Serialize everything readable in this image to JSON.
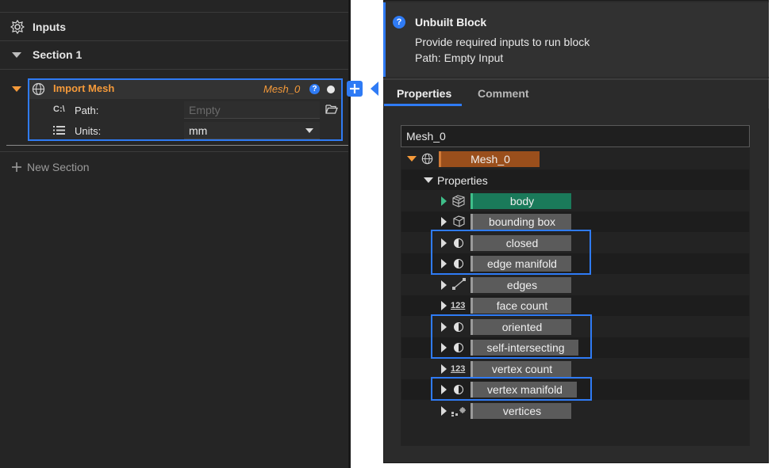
{
  "left_panel": {
    "inputs_label": "Inputs",
    "section_label": "Section 1",
    "block": {
      "name": "Import Mesh",
      "output_name": "Mesh_0",
      "help_glyph": "?",
      "path_label": "Path:",
      "path_icon_text": "C:\\",
      "path_placeholder": "Empty",
      "units_label": "Units:",
      "units_value": "mm"
    },
    "new_section_label": "New Section"
  },
  "tooltip": {
    "icon_glyph": "?",
    "title": "Unbuilt Block",
    "line1": "Provide required inputs to run block",
    "line2": "Path: Empty Input"
  },
  "tabs": [
    {
      "label": "Properties",
      "active": true
    },
    {
      "label": "Comment",
      "active": false
    }
  ],
  "tree": {
    "search_value": "Mesh_0",
    "root": "Mesh_0",
    "group": "Properties",
    "items": [
      {
        "label": "body",
        "icon": "body-mesh-icon"
      },
      {
        "label": "bounding box",
        "icon": "bounding-box-icon"
      },
      {
        "label": "closed",
        "icon": "half-circle-icon"
      },
      {
        "label": "edge manifold",
        "icon": "half-circle-icon"
      },
      {
        "label": "edges",
        "icon": "edge-icon"
      },
      {
        "label": "face count",
        "icon": "number-icon"
      },
      {
        "label": "oriented",
        "icon": "half-circle-icon"
      },
      {
        "label": "self-intersecting",
        "icon": "half-circle-icon"
      },
      {
        "label": "vertex count",
        "icon": "number-icon"
      },
      {
        "label": "vertex manifold",
        "icon": "half-circle-icon"
      },
      {
        "label": "vertices",
        "icon": "vertices-icon"
      }
    ],
    "number_icon_text": "123"
  },
  "colors": {
    "accent_blue": "#2f7bf5",
    "orange": "#f59a3a",
    "root_chip": "#9a4f1c",
    "body_chip": "#1a7a5a",
    "panel_bg": "#252525"
  }
}
